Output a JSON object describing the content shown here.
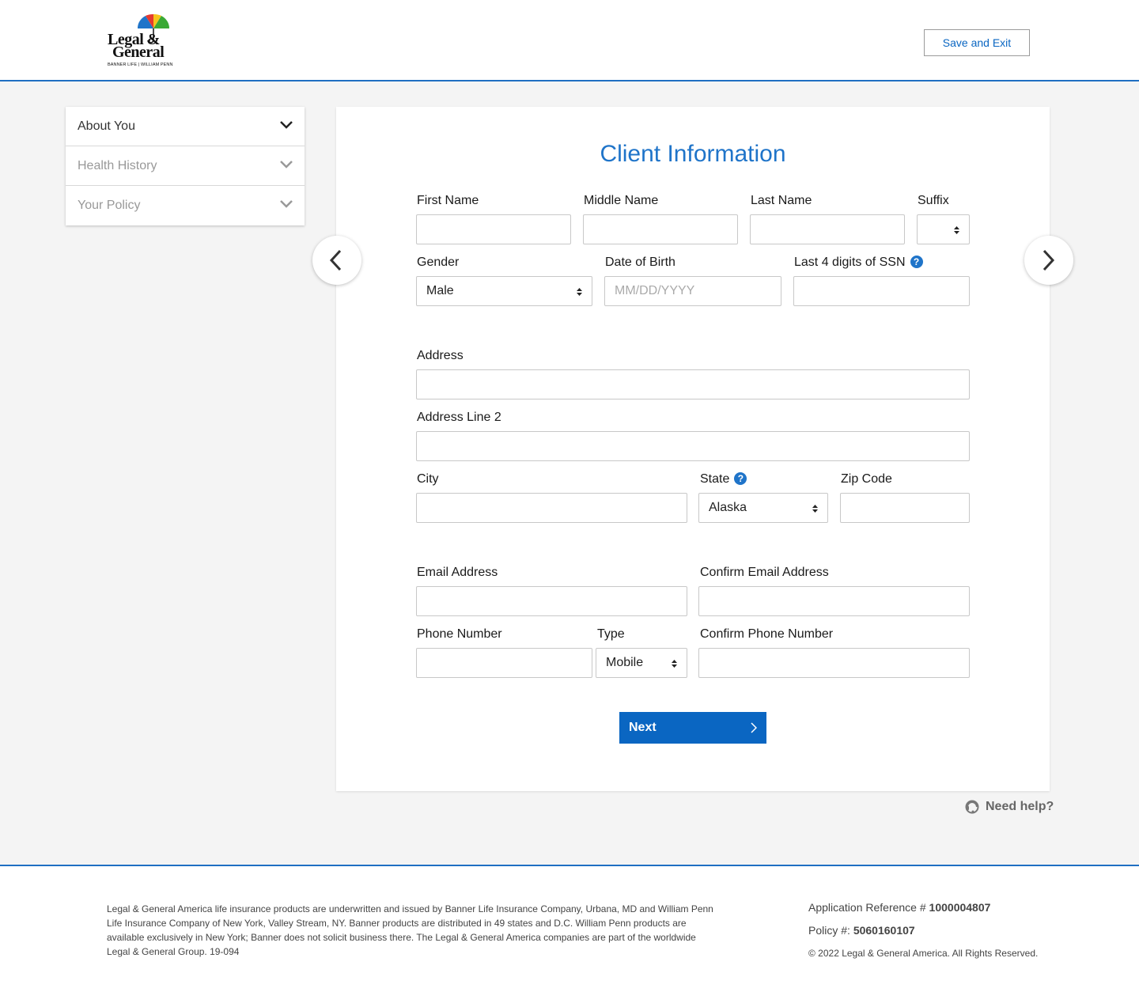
{
  "header": {
    "logo_line1": "Legal &",
    "logo_line2": "General",
    "logo_sub": "BANNER LIFE | WILLIAM PENN",
    "save_exit_label": "Save and Exit"
  },
  "sidebar": {
    "items": [
      {
        "label": "About You",
        "active": true
      },
      {
        "label": "Health History",
        "active": false
      },
      {
        "label": "Your Policy",
        "active": false
      }
    ]
  },
  "form": {
    "title": "Client Information",
    "first_name_label": "First Name",
    "middle_name_label": "Middle Name",
    "last_name_label": "Last Name",
    "suffix_label": "Suffix",
    "suffix_value": "",
    "gender_label": "Gender",
    "gender_value": "Male",
    "dob_label": "Date of Birth",
    "dob_placeholder": "MM/DD/YYYY",
    "ssn_label": "Last 4 digits of SSN",
    "address_label": "Address",
    "address2_label": "Address Line 2",
    "city_label": "City",
    "state_label": "State",
    "state_value": "Alaska",
    "zip_label": "Zip Code",
    "email_label": "Email Address",
    "confirm_email_label": "Confirm Email Address",
    "phone_label": "Phone Number",
    "type_label": "Type",
    "type_value": "Mobile",
    "confirm_phone_label": "Confirm Phone Number",
    "help_glyph": "?",
    "next_label": "Next"
  },
  "need_help_label": "Need help?",
  "footer": {
    "disclaimer": "Legal & General America life insurance products are underwritten and issued by Banner Life Insurance Company, Urbana, MD and William Penn Life Insurance Company of New York, Valley Stream, NY. Banner products are distributed in 49 states and D.C. William Penn products are available exclusively in New York; Banner does not solicit business there. The Legal & General America companies are part of the worldwide Legal & General Group. 19-094",
    "app_ref_label": "Application Reference #",
    "app_ref_value": "1000004807",
    "policy_label": "Policy #:",
    "policy_value": "5060160107",
    "copyright": "© 2022 Legal & General America. All Rights Reserved."
  },
  "colors": {
    "accent": "#0a66c2",
    "title_blue": "#1f74c9",
    "background": "#f4f4f4"
  }
}
